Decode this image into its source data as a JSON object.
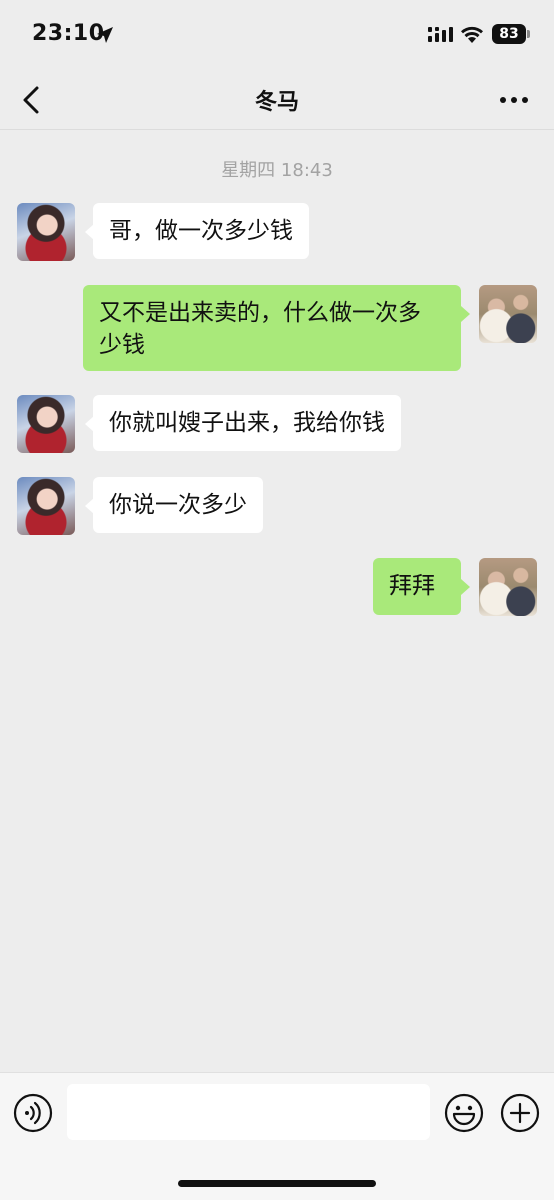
{
  "status_bar": {
    "time": "23:10",
    "battery": "83"
  },
  "nav": {
    "title": "冬马"
  },
  "chat": {
    "timestamp": "星期四 18:43",
    "messages": [
      {
        "side": "in",
        "text": "哥，做一次多少钱"
      },
      {
        "side": "out",
        "text": "又不是出来卖的，什么做一次多\n少钱"
      },
      {
        "side": "in",
        "text": "你就叫嫂子出来，我给你钱"
      },
      {
        "side": "in",
        "text": "你说一次多少"
      },
      {
        "side": "out",
        "text": "拜拜"
      }
    ]
  },
  "input_bar": {
    "text_value": ""
  },
  "icons": {
    "back": "chevron-left-icon",
    "more": "more-dots-icon",
    "voice": "voice-icon",
    "emoji": "emoji-icon",
    "plus": "plus-icon"
  },
  "colors": {
    "background": "#ededed",
    "incoming_bubble": "#ffffff",
    "outgoing_bubble": "#a9e97a",
    "timestamp_text": "#a3a3a3"
  }
}
